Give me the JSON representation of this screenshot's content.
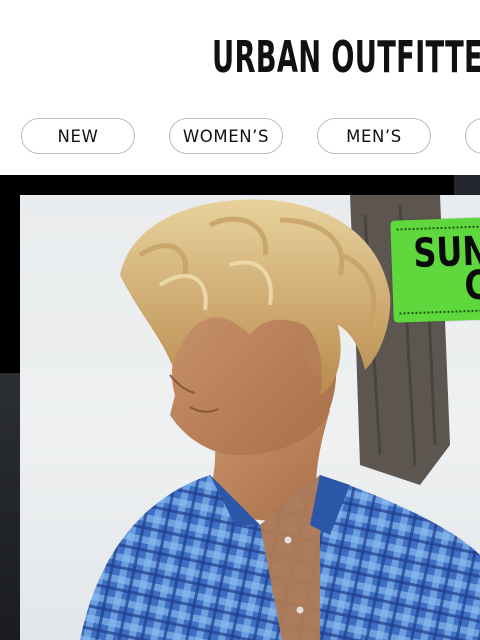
{
  "header": {
    "logo_text": "URBAN OUTFITTERS"
  },
  "nav": {
    "items": [
      {
        "label": "NEW"
      },
      {
        "label": "WOMEN’S"
      },
      {
        "label": "MEN’S"
      },
      {
        "label": ""
      }
    ]
  },
  "hero": {
    "sticker_line1": "SUN",
    "sticker_line2": "C",
    "sticker_color": "#5fd83d",
    "image_subject": "man-in-blue-plaid-shirt"
  },
  "colors": {
    "background": "#ffffff",
    "text": "#111111",
    "pill_border": "#bdbdbd",
    "hero_frame": "#000000"
  }
}
